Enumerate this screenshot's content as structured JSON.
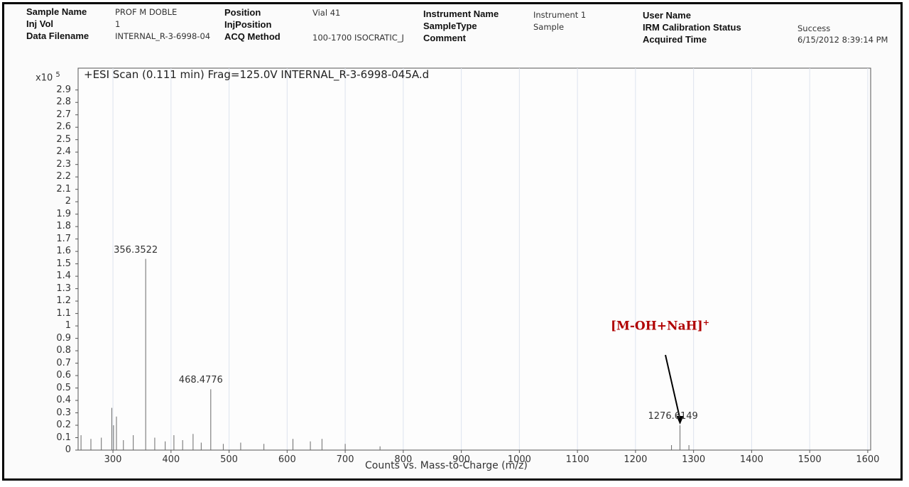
{
  "header": {
    "sample_name_label": "Sample Name",
    "sample_name_value": "PROF M DOBLE",
    "inj_vol_label": "Inj Vol",
    "inj_vol_value": "1",
    "data_filename_label": "Data Filename",
    "data_filename_value": "INTERNAL_R-3-6998-04",
    "position_label": "Position",
    "position_value": "Vial 41",
    "injposition_label": "InjPosition",
    "acq_method_label": "ACQ Method",
    "acq_method_value": "100-1700 ISOCRATIC_J",
    "instrument_name_label": "Instrument Name",
    "instrument_name_value": "Instrument 1",
    "sampletype_label": "SampleType",
    "sampletype_value": "Sample",
    "comment_label": "Comment",
    "user_name_label": "User Name",
    "irm_label": "IRM Calibration Status",
    "irm_value": "Success",
    "acquired_time_label": "Acquired Time",
    "acquired_time_value": "6/15/2012 8:39:14 PM"
  },
  "chart_data": {
    "type": "bar",
    "title": "+ESI Scan (0.111 min) Frag=125.0V INTERNAL_R-3-6998-045A.d",
    "xlabel": "Counts vs. Mass-to-Charge (m/z)",
    "ylabel": "",
    "y_multiplier": "x10",
    "y_multiplier_exp": "5",
    "xlim": [
      240,
      1605
    ],
    "ylim": [
      0,
      2.95
    ],
    "x_ticks": [
      300,
      400,
      500,
      600,
      700,
      800,
      900,
      1000,
      1100,
      1200,
      1300,
      1400,
      1500,
      1600
    ],
    "y_ticks": [
      0,
      0.1,
      0.2,
      0.3,
      0.4,
      0.5,
      0.6,
      0.7,
      0.8,
      0.9,
      1,
      1.1,
      1.2,
      1.3,
      1.4,
      1.5,
      1.6,
      1.7,
      1.8,
      1.9,
      2,
      2.1,
      2.2,
      2.3,
      2.4,
      2.5,
      2.6,
      2.7,
      2.8,
      2.9
    ],
    "y_tick_labels": [
      "0",
      "0.1",
      "0.2",
      "0.3",
      "0.4",
      "0.5",
      "0.6",
      "0.7",
      "0.8",
      "0.9",
      "1",
      "1.1",
      "1.2",
      "1.3",
      "1.4",
      "1.5",
      "1.6",
      "1.7",
      "1.8",
      "1.9",
      "2",
      "2.1",
      "2.2",
      "2.3",
      "2.4",
      "2.5",
      "2.6",
      "2.7",
      "2.8",
      "2.9"
    ],
    "grid": true,
    "peaks": [
      {
        "mz": 245,
        "intensity": 0.12
      },
      {
        "mz": 262,
        "intensity": 0.09
      },
      {
        "mz": 280,
        "intensity": 0.1
      },
      {
        "mz": 298,
        "intensity": 0.34
      },
      {
        "mz": 301,
        "intensity": 0.2
      },
      {
        "mz": 306,
        "intensity": 0.27
      },
      {
        "mz": 318,
        "intensity": 0.08
      },
      {
        "mz": 335,
        "intensity": 0.12
      },
      {
        "mz": 356.3522,
        "intensity": 1.54
      },
      {
        "mz": 372,
        "intensity": 0.1
      },
      {
        "mz": 390,
        "intensity": 0.07
      },
      {
        "mz": 405,
        "intensity": 0.12
      },
      {
        "mz": 420,
        "intensity": 0.08
      },
      {
        "mz": 438,
        "intensity": 0.13
      },
      {
        "mz": 452,
        "intensity": 0.06
      },
      {
        "mz": 468.4776,
        "intensity": 0.49
      },
      {
        "mz": 490,
        "intensity": 0.05
      },
      {
        "mz": 520,
        "intensity": 0.06
      },
      {
        "mz": 560,
        "intensity": 0.05
      },
      {
        "mz": 610,
        "intensity": 0.09
      },
      {
        "mz": 640,
        "intensity": 0.07
      },
      {
        "mz": 660,
        "intensity": 0.09
      },
      {
        "mz": 700,
        "intensity": 0.05
      },
      {
        "mz": 760,
        "intensity": 0.03
      },
      {
        "mz": 1262,
        "intensity": 0.04
      },
      {
        "mz": 1276.6149,
        "intensity": 0.2
      },
      {
        "mz": 1292,
        "intensity": 0.04
      }
    ],
    "peak_labels": [
      {
        "mz": 356.3522,
        "intensity": 1.54,
        "text": "356.3522"
      },
      {
        "mz": 468.4776,
        "intensity": 0.49,
        "text": "468.4776"
      },
      {
        "mz": 1276.6149,
        "intensity": 0.2,
        "text": "1276.6149"
      }
    ],
    "annotation": {
      "text": "[M-OH+NaH]",
      "sup": "+",
      "color": "#b00000",
      "target_mz": 1276.6149
    }
  }
}
